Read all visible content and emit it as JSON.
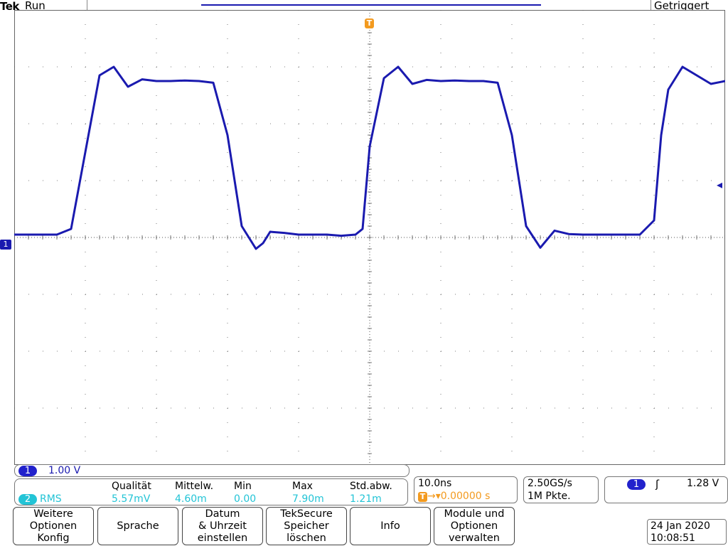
{
  "header": {
    "brand": "Tek",
    "run_state": "Run",
    "trigger_state": "Getriggert"
  },
  "markers": {
    "trigger_marker": "T",
    "ch1_marker": "1",
    "trigger_level_arrow": "◂"
  },
  "colors": {
    "ch1": "#1a1aaf",
    "ch2": "#23c4d6",
    "trigger": "#f39a1e"
  },
  "channel_scale": {
    "channel": "1",
    "value": "1.00 V"
  },
  "measurements": {
    "channel": "2",
    "type": "RMS",
    "headers": [
      "Qualität",
      "Mittelw.",
      "Min",
      "Max",
      "Std.abw."
    ],
    "values": [
      "5.57mV",
      "4.60m",
      "0.00",
      "7.90m",
      "1.21m"
    ]
  },
  "timebase": {
    "per_div": "10.0ns",
    "position": "→▾0.00000 s"
  },
  "acquisition": {
    "sample_rate": "2.50GS/s",
    "record_length": "1M Pkte."
  },
  "trigger": {
    "source": "1",
    "slope": "ʃ",
    "level": "1.28 V"
  },
  "softkeys": [
    "Weitere\nOptionen\nKonfig",
    "Sprache",
    "Datum\n& Uhrzeit\neinstellen",
    "TekSecure\nSpeicher\nlöschen",
    "Info",
    "Module und\nOptionen\nverwalten"
  ],
  "datetime": {
    "date": "24 Jan  2020",
    "time": "10:08:51"
  },
  "chart_data": {
    "type": "line",
    "x_unit": "ns",
    "y_unit": "V",
    "series": [
      {
        "x": [
          -50,
          -44,
          -42,
          -40,
          -38,
          -36,
          -34,
          -32,
          -30,
          -28,
          -26,
          -24,
          -22,
          -20,
          -18,
          -16,
          -15,
          -14,
          -12,
          -10,
          -8,
          -6,
          -4,
          -2,
          -1,
          0,
          2,
          4,
          6,
          8,
          10,
          12,
          14,
          16,
          18,
          20,
          22,
          24,
          26,
          28,
          30,
          32,
          34,
          36,
          38,
          40,
          41,
          42,
          44,
          46,
          48,
          50
        ],
        "y": [
          0.05,
          0.05,
          0.15,
          1.5,
          2.85,
          3.0,
          2.65,
          2.78,
          2.75,
          2.75,
          2.76,
          2.75,
          2.72,
          1.8,
          0.2,
          -0.2,
          -0.1,
          0.1,
          0.08,
          0.05,
          0.05,
          0.05,
          0.03,
          0.05,
          0.15,
          1.6,
          2.8,
          3.0,
          2.7,
          2.77,
          2.75,
          2.76,
          2.75,
          2.75,
          2.72,
          1.8,
          0.2,
          -0.18,
          0.12,
          0.06,
          0.05,
          0.05,
          0.05,
          0.05,
          0.05,
          0.3,
          1.8,
          2.6,
          3.0,
          2.85,
          2.7,
          2.75
        ]
      }
    ],
    "xlim": [
      -50,
      50
    ],
    "ylim": [
      -4,
      4
    ],
    "x_divisions": 10,
    "y_divisions": 8,
    "grid": true
  }
}
